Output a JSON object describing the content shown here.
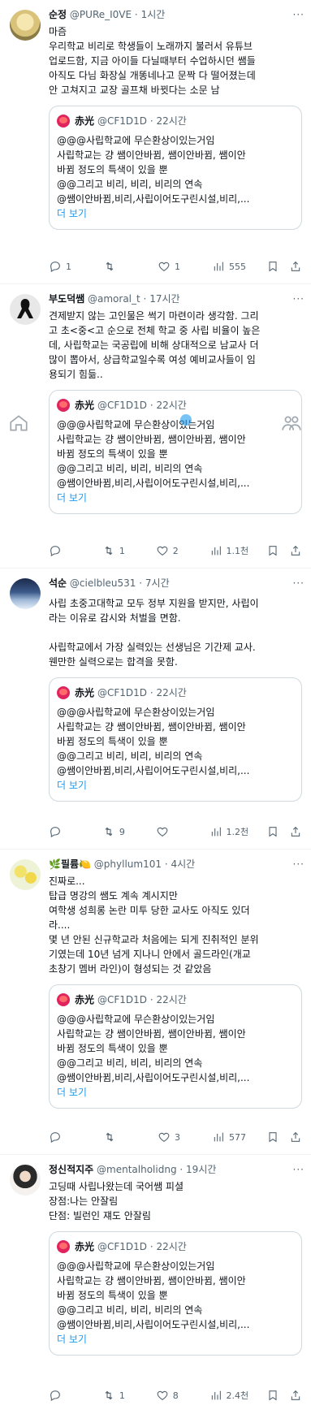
{
  "colors": {
    "accent": "#1d9bf0",
    "text": "#0f1419",
    "muted": "#536471",
    "border": "#cfd9de"
  },
  "quote": {
    "name": "赤光",
    "handle": "@CF1D1D",
    "time": "22시간",
    "lines": [
      "@@@사립학교에 무슨환상이있는거임",
      "사립학교는 걍 쌤이안바뀜, 쌤이안바뀜, 쌤이안",
      "바뀜 정도의 특색이 있을 뿐",
      "@@그리고 비리, 비리, 비리의 연속",
      "@쌤이안바뀜,비리,사립이어도구린시설,비리,..."
    ],
    "more": "더 보기"
  },
  "posts": [
    {
      "name": "순정",
      "handle": "@PURe_I0VE",
      "time": "1시간",
      "lines": [
        "마즘",
        "우리학교 비리로 학생들이 노래까지 불러서 유튜브",
        "업로드함, 지금 아이들 다닐때부터 수업하시던 쌤들",
        "아직도 다님 화장실 개똥네나고 문짝 다 떨어졌는데",
        "안 고쳐지고 교장 골프채 바뀟다는 소문 남"
      ],
      "replies": "1",
      "reposts": "",
      "likes": "1",
      "views": "555"
    },
    {
      "name": "부도덕쌤",
      "handle": "@amoral_t",
      "time": "17시간",
      "lines": [
        "견제받지 않는 고인물은 썩기 마련이라 생각함. 그리",
        "고 초<중<고 순으로 전체 학교 중 사립 비율이 높은",
        "데, 사립학교는 국공립에 비해 상대적으로 남교사 더",
        "많이 뽑아서, 상급학교일수록 여성 예비교사들이 임",
        "용되기 힘듦.."
      ],
      "replies": "",
      "reposts": "1",
      "likes": "2",
      "views": "1.1천"
    },
    {
      "name": "석순",
      "handle": "@cielbleu531",
      "time": "7시간",
      "lines": [
        "사립 초중고대학교 모두 정부 지원을 받지만, 사립이",
        "라는 이유로 감시와 처벌을 면함.",
        "",
        "사립학교에서 가장 실력있는 선생님은 기간제 교사.",
        "웬만한 실력으로는 합격을 못함."
      ],
      "replies": "",
      "reposts": "9",
      "likes": "",
      "views": "1.2천"
    },
    {
      "name": "🌿필륨🍋",
      "handle": "@phyllum101",
      "time": "4시간",
      "lines": [
        "진짜로...",
        "탑급 명강의 쌤도 계속 계시지만",
        "여학생 성희롱 논란 미투 당한 교사도 아직도 있더",
        "라....",
        "몇 년 안된 신규학교라 처음에는 되게 진취적인 분위",
        "기였는데 10년 넘게 지나니 안에서 골드라인(개교",
        "초창기 멤버 라인)이 형성되는 것 같았음"
      ],
      "replies": "",
      "reposts": "",
      "likes": "3",
      "views": "577"
    },
    {
      "name": "정신적지주",
      "handle": "@mentalholidng",
      "time": "19시간",
      "lines": [
        "고딩때 사립나왔는데 국어쌤 피셜",
        "장점:나는 안잘림",
        "단점: 빌런인 쟤도 안잘림"
      ],
      "replies": "",
      "reposts": "1",
      "likes": "8",
      "views": "2.4천"
    }
  ]
}
